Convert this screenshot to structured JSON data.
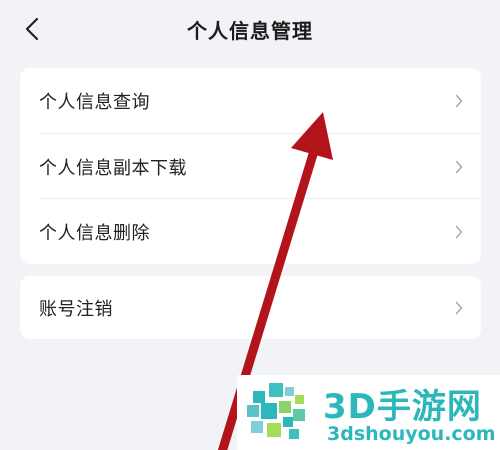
{
  "header": {
    "title": "个人信息管理",
    "back_icon": "chevron-left-icon"
  },
  "menu_group_1": [
    {
      "label": "个人信息查询"
    },
    {
      "label": "个人信息副本下载"
    },
    {
      "label": "个人信息删除"
    }
  ],
  "menu_group_2": [
    {
      "label": "账号注销"
    }
  ],
  "row_icon": "chevron-right-icon",
  "overlay": {
    "arrow_color": "#b3141c"
  },
  "watermark": {
    "title": "3D手游网",
    "url": "3dshouyou.com",
    "color": "#2cb7bd"
  }
}
